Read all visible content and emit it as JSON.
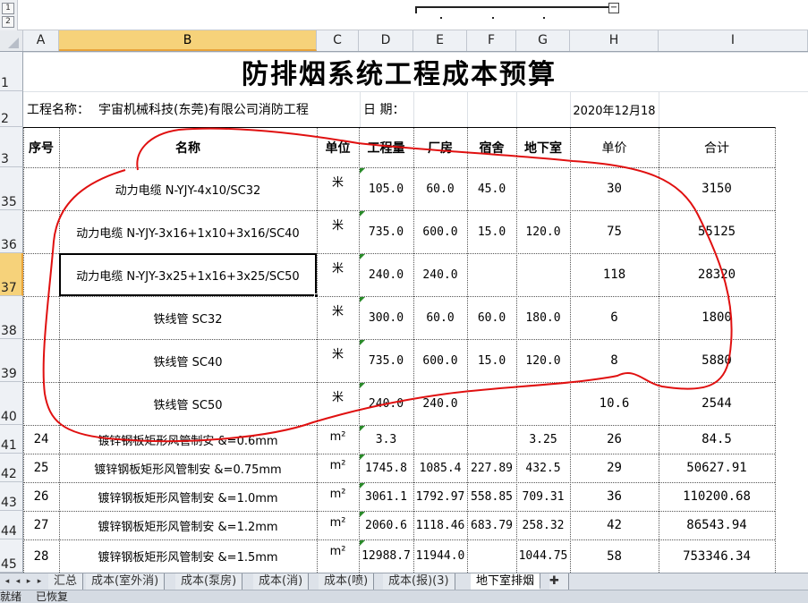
{
  "group_levels": [
    "1",
    "2"
  ],
  "collapse_symbol": "−",
  "columns": [
    "A",
    "B",
    "C",
    "D",
    "E",
    "F",
    "G",
    "H",
    "I"
  ],
  "selected_column": "B",
  "title": "防排烟系统工程成本预算",
  "project_label": "工程名称：",
  "project_name": "宇宙机械科技(东莞)有限公司消防工程",
  "date_label": "日  期：",
  "date_value": "2020年12月18",
  "headers": {
    "seq": "序号",
    "name": "名称",
    "unit": "单位",
    "qty": "工程量",
    "plant": "厂房",
    "dorm": "宿舍",
    "basement": "地下室",
    "price": "单价",
    "total": "合计"
  },
  "row_numbers": [
    "1",
    "2",
    "3",
    "35",
    "36",
    "37",
    "38",
    "39",
    "40",
    "41",
    "42",
    "43",
    "44",
    "45"
  ],
  "selected_row": "37",
  "rows": [
    {
      "row": "35",
      "seq": "",
      "name": "动力电缆 N-YJY-4x10/SC32",
      "unit": "米",
      "qty": "105.0",
      "plant": "60.0",
      "dorm": "45.0",
      "basement": "",
      "price": "30",
      "total": "3150"
    },
    {
      "row": "36",
      "seq": "",
      "name": "动力电缆 N-YJY-3x16+1x10+3x16/SC40",
      "unit": "米",
      "qty": "735.0",
      "plant": "600.0",
      "dorm": "15.0",
      "basement": "120.0",
      "price": "75",
      "total": "55125"
    },
    {
      "row": "37",
      "seq": "",
      "name": "动力电缆 N-YJY-3x25+1x16+3x25/SC50",
      "unit": "米",
      "qty": "240.0",
      "plant": "240.0",
      "dorm": "",
      "basement": "",
      "price": "118",
      "total": "28320"
    },
    {
      "row": "38",
      "seq": "",
      "name": "铁线管  SC32",
      "unit": "米",
      "qty": "300.0",
      "plant": "60.0",
      "dorm": "60.0",
      "basement": "180.0",
      "price": "6",
      "total": "1800"
    },
    {
      "row": "39",
      "seq": "",
      "name": "铁线管  SC40",
      "unit": "米",
      "qty": "735.0",
      "plant": "600.0",
      "dorm": "15.0",
      "basement": "120.0",
      "price": "8",
      "total": "5880"
    },
    {
      "row": "40",
      "seq": "",
      "name": "铁线管  SC50",
      "unit": "米",
      "qty": "240.0",
      "plant": "240.0",
      "dorm": "",
      "basement": "",
      "price": "10.6",
      "total": "2544"
    },
    {
      "row": "41",
      "seq": "24",
      "name": "镀锌钢板矩形风管制安  &=0.6mm",
      "unit": "m²",
      "qty": "3.3",
      "plant": "",
      "dorm": "",
      "basement": "3.25",
      "price": "26",
      "total": "84.5"
    },
    {
      "row": "42",
      "seq": "25",
      "name": "镀锌钢板矩形风管制安  &=0.75mm",
      "unit": "m²",
      "qty": "1745.8",
      "plant": "1085.4",
      "dorm": "227.89",
      "basement": "432.5",
      "price": "29",
      "total": "50627.91"
    },
    {
      "row": "43",
      "seq": "26",
      "name": "镀锌钢板矩形风管制安  &=1.0mm",
      "unit": "m²",
      "qty": "3061.1",
      "plant": "1792.97",
      "dorm": "558.85",
      "basement": "709.31",
      "price": "36",
      "total": "110200.68"
    },
    {
      "row": "44",
      "seq": "27",
      "name": "镀锌钢板矩形风管制安  &=1.2mm",
      "unit": "m²",
      "qty": "2060.6",
      "plant": "1118.46",
      "dorm": "683.79",
      "basement": "258.32",
      "price": "42",
      "total": "86543.94"
    },
    {
      "row": "45",
      "seq": "28",
      "name": "镀锌钢板矩形风管制安  &=1.5mm",
      "unit": "m²",
      "qty": "12988.7",
      "plant": "11944.0",
      "dorm": "",
      "basement": "1044.75",
      "price": "58",
      "total": "753346.34"
    }
  ],
  "sheet_tabs": [
    "汇总",
    "成本(室外消)",
    "成本(泵房)",
    "成本(消)",
    "成本(喷)",
    "成本(报)(3)",
    "地下室排烟"
  ],
  "active_tab": "地下室排烟",
  "status": [
    "就绪",
    "已恢复"
  ],
  "colors": {
    "selection_header": "#f6d27a",
    "annotation": "#e01010",
    "error_triangle": "#2a8a2a"
  }
}
